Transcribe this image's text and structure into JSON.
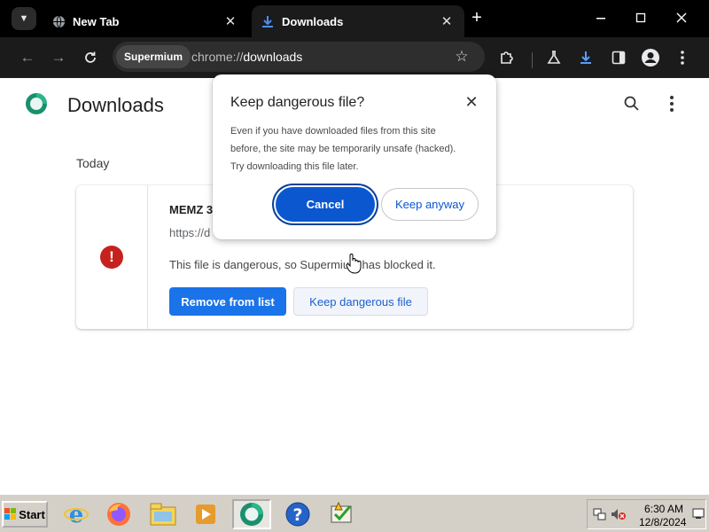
{
  "tabs": [
    {
      "title": "New Tab",
      "icon": "globe-icon",
      "active": false
    },
    {
      "title": "Downloads",
      "icon": "download-icon",
      "active": true
    }
  ],
  "omnibox": {
    "site_chip": "Supermium",
    "url_scheme": "chrome://",
    "url_host": "downloads"
  },
  "page": {
    "title": "Downloads",
    "section": "Today"
  },
  "download_item": {
    "file_name": "MEMZ 3",
    "url": "https://d",
    "danger_message": "This file is dangerous, so Supermium has blocked it.",
    "remove_label": "Remove from list",
    "keep_label": "Keep dangerous file"
  },
  "dialog": {
    "title": "Keep dangerous file?",
    "body_line1": "Even if you have downloaded files from this site",
    "body_line2": "before, the site may be temporarily unsafe (hacked).",
    "body_line3": "Try downloading this file later.",
    "cancel_label": "Cancel",
    "keep_label": "Keep anyway"
  },
  "taskbar": {
    "start_label": "Start",
    "apps": [
      "internet-explorer-icon",
      "firefox-icon",
      "explorer-icon",
      "media-player-icon",
      "supermium-icon",
      "help-icon",
      "task-icon"
    ],
    "clock_time": "6:30 AM",
    "clock_date": "12/8/2024"
  },
  "colors": {
    "accent_blue": "#1a73e8",
    "dialog_button_blue": "#0b57d0",
    "danger_red": "#c5221f",
    "chrome_dark": "#1b1b1b"
  }
}
